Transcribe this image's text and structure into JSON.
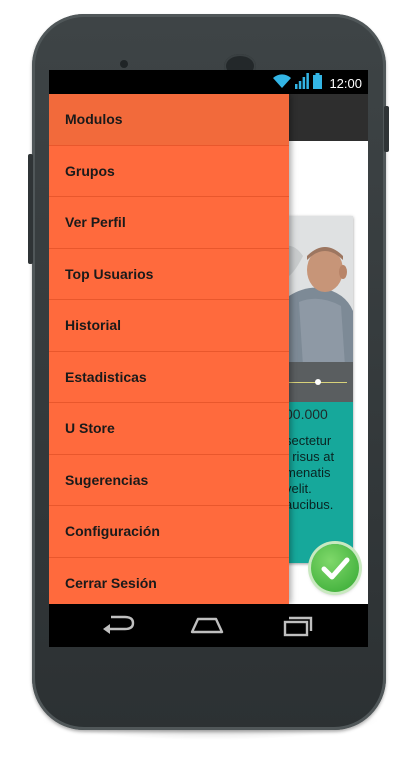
{
  "status_bar": {
    "time": "12:00",
    "icons": [
      "wifi-icon",
      "signal-icon",
      "battery-icon"
    ]
  },
  "card": {
    "price": "00.000",
    "text_lines": [
      "sectetur",
      ", risus at",
      "menatis",
      "velit.",
      "aucibus."
    ]
  },
  "drawer": {
    "items": [
      {
        "label": "Modulos",
        "active": true
      },
      {
        "label": "Grupos"
      },
      {
        "label": "Ver Perfil"
      },
      {
        "label": "Top Usuarios"
      },
      {
        "label": "Historial"
      },
      {
        "label": "Estadisticas"
      },
      {
        "label": "U Store"
      },
      {
        "label": "Sugerencias"
      },
      {
        "label": "Configuración"
      },
      {
        "label": "Cerrar Sesión"
      }
    ]
  },
  "nav_bar": {
    "icons": [
      "back-icon",
      "home-icon",
      "recent-apps-icon"
    ]
  },
  "colors": {
    "drawer": "#ff6a3d",
    "card_accent": "#16a89b",
    "check": "#4cc23f"
  }
}
